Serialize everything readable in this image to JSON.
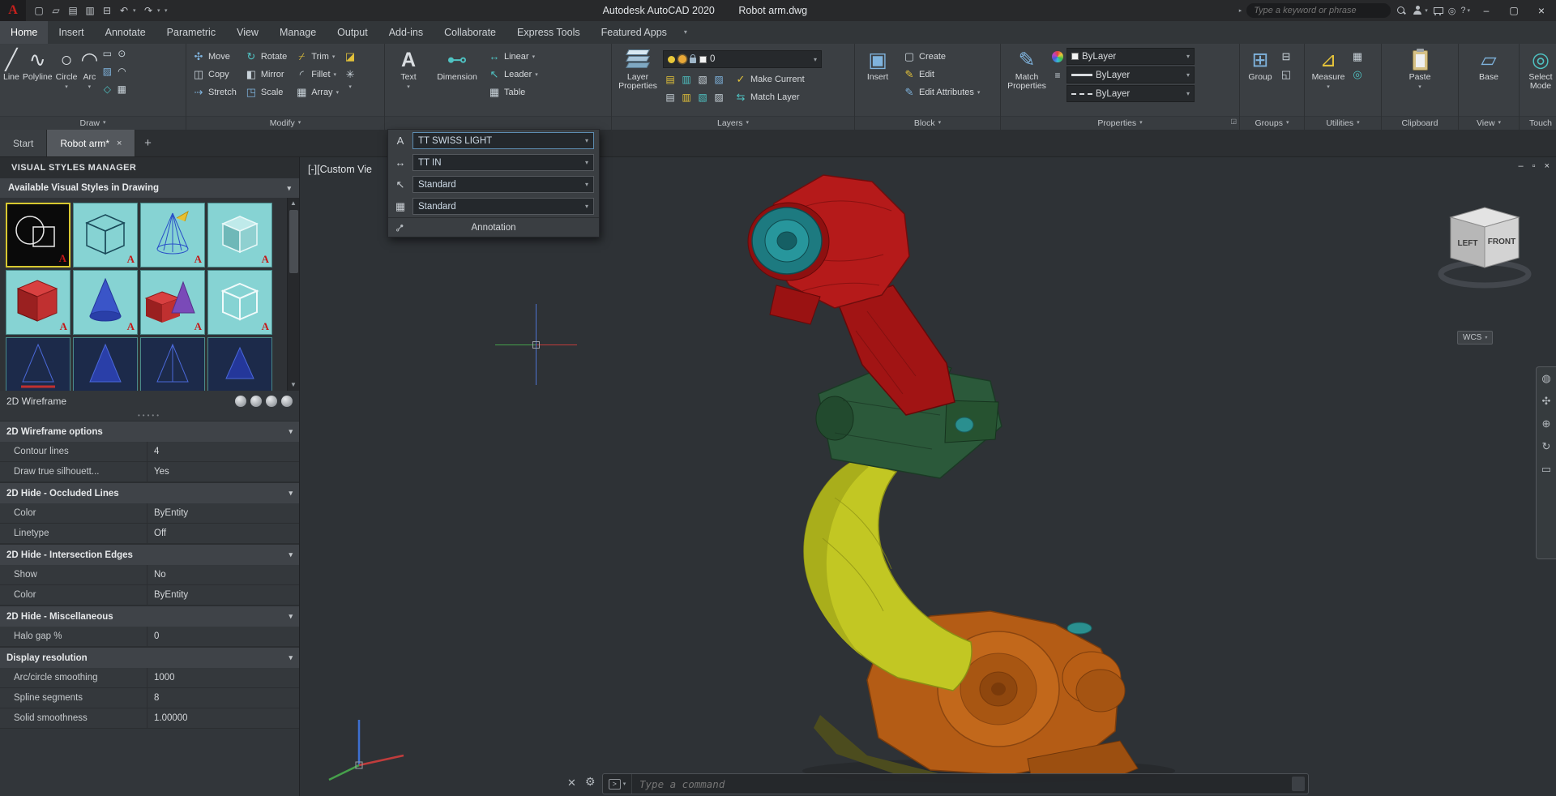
{
  "titlebar": {
    "logo": "A",
    "app_title": "Autodesk AutoCAD 2020",
    "doc_title": "Robot arm.dwg",
    "search_placeholder": "Type a keyword or phrase",
    "help_label": "?"
  },
  "menu_tabs": [
    "Home",
    "Insert",
    "Annotate",
    "Parametric",
    "View",
    "Manage",
    "Output",
    "Add-ins",
    "Collaborate",
    "Express Tools",
    "Featured Apps"
  ],
  "ribbon": {
    "draw": {
      "label": "Draw",
      "line": "Line",
      "polyline": "Polyline",
      "circle": "Circle",
      "arc": "Arc"
    },
    "modify": {
      "label": "Modify",
      "move": "Move",
      "copy": "Copy",
      "stretch": "Stretch",
      "rotate": "Rotate",
      "mirror": "Mirror",
      "scale": "Scale",
      "trim": "Trim",
      "fillet": "Fillet",
      "array": "Array"
    },
    "annotation": {
      "text": "Text",
      "dimension": "Dimension",
      "linear": "Linear",
      "leader": "Leader",
      "table": "Table"
    },
    "layers": {
      "label": "Layers",
      "big": "Layer Properties",
      "layer_value": "0",
      "make_current": "Make Current",
      "match_layer": "Match Layer"
    },
    "block": {
      "label": "Block",
      "insert": "Insert",
      "create": "Create",
      "edit": "Edit",
      "edit_attributes": "Edit Attributes"
    },
    "properties": {
      "label": "Properties",
      "big": "Match Properties",
      "color_value": "ByLayer",
      "lineweight_value": "ByLayer",
      "linetype_value": "ByLayer"
    },
    "groups": {
      "label": "Groups",
      "big": "Group"
    },
    "utilities": {
      "label": "Utilities",
      "big": "Measure"
    },
    "clipboard": {
      "label": "Clipboard",
      "big": "Paste"
    },
    "view": {
      "label": "View",
      "big": "Base"
    },
    "touch": {
      "label": "Touch",
      "big": "Select Mode"
    }
  },
  "file_tabs": {
    "start": "Start",
    "doc": "Robot arm*",
    "new_tab": "+"
  },
  "annotation_flyout": {
    "text_style": "TT SWISS LIGHT",
    "dim_style": "TT IN",
    "leader_style": "Standard",
    "table_style": "Standard",
    "footer": "Annotation"
  },
  "palette": {
    "title": "VISUAL STYLES MANAGER",
    "section": "Available Visual Styles in Drawing",
    "style_name": "2D Wireframe",
    "badge": "A",
    "groups": [
      {
        "title": "2D Wireframe options",
        "rows": [
          [
            "Contour lines",
            "4"
          ],
          [
            "Draw true silhouett...",
            "Yes"
          ]
        ]
      },
      {
        "title": "2D Hide - Occluded Lines",
        "rows": [
          [
            "Color",
            "ByEntity"
          ],
          [
            "Linetype",
            "Off"
          ]
        ]
      },
      {
        "title": "2D Hide - Intersection Edges",
        "rows": [
          [
            "Show",
            "No"
          ],
          [
            "Color",
            "ByEntity"
          ]
        ]
      },
      {
        "title": "2D Hide - Miscellaneous",
        "rows": [
          [
            "Halo gap %",
            "0"
          ]
        ]
      },
      {
        "title": "Display resolution",
        "rows": [
          [
            "Arc/circle smoothing",
            "1000"
          ],
          [
            "Spline segments",
            "8"
          ],
          [
            "Solid smoothness",
            "1.00000"
          ]
        ]
      }
    ]
  },
  "viewport": {
    "label": "[-][Custom Vie",
    "viewcube_left": "LEFT",
    "viewcube_front": "FRONT",
    "wcs": "WCS",
    "command_placeholder": "Type a command"
  }
}
